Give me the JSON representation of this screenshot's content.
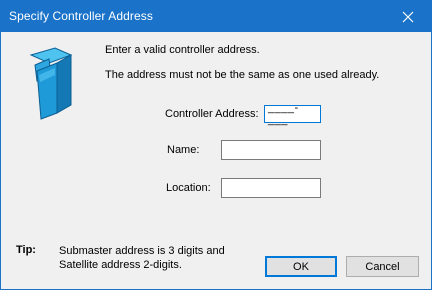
{
  "window": {
    "title": "Specify Controller Address",
    "accent": "#1a73c9"
  },
  "icons": {
    "close": "close-icon",
    "device": "controller-device-icon"
  },
  "messages": {
    "line1": "Enter a valid controller address.",
    "line2": "The address must not be the same as one used already."
  },
  "form": {
    "address_label": "Controller Address:",
    "address_value": "____-___",
    "name_label": "Name:",
    "name_value": "",
    "location_label": "Location:",
    "location_value": ""
  },
  "tip": {
    "label": "Tip:",
    "line1": "Submaster address is 3 digits and",
    "line2": "Satellite address 2-digits."
  },
  "buttons": {
    "ok": "OK",
    "cancel": "Cancel"
  }
}
